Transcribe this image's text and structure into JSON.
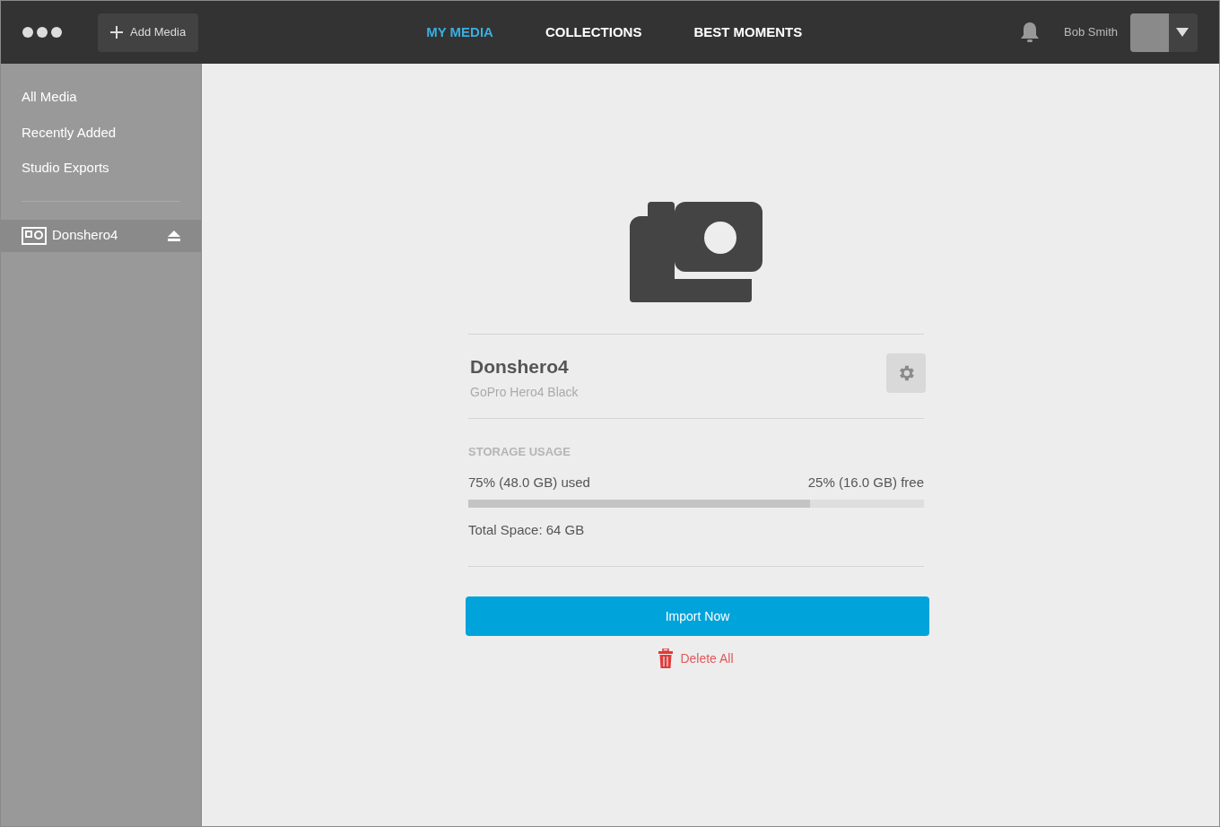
{
  "header": {
    "add_media_label": "Add Media",
    "tabs": [
      {
        "label": "MY MEDIA",
        "selected": true
      },
      {
        "label": "COLLECTIONS",
        "selected": false
      },
      {
        "label": "BEST MOMENTS",
        "selected": false
      }
    ],
    "user_name": "Bob Smith"
  },
  "sidebar": {
    "library": [
      {
        "label": "All Media",
        "selected": false
      },
      {
        "label": "Recently Added",
        "selected": false
      },
      {
        "label": "Studio Exports",
        "selected": false
      }
    ],
    "devices": [
      {
        "label": "Donshero4",
        "selected": true
      }
    ]
  },
  "device": {
    "name": "Donshero4",
    "model": "GoPro Hero4 Black",
    "storage": {
      "heading": "STORAGE USAGE",
      "used": "75% (48.0 GB) used",
      "free": "25% (16.0 GB) free",
      "level": 0.75,
      "total": "Total Space: 64 GB"
    },
    "import_label": "Import Now",
    "delete_label": "Delete All"
  }
}
